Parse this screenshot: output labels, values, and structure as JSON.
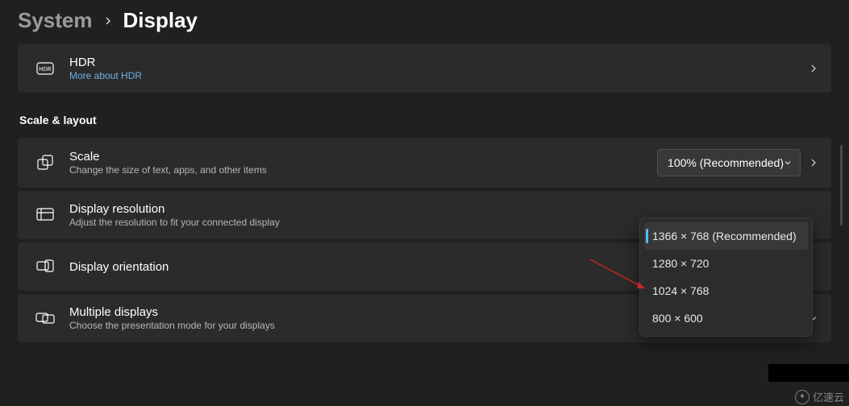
{
  "breadcrumb": {
    "parent": "System",
    "current": "Display"
  },
  "hdr_card": {
    "title": "HDR",
    "link": "More about HDR"
  },
  "section_scale": "Scale & layout",
  "scale_card": {
    "title": "Scale",
    "subtitle": "Change the size of text, apps, and other items",
    "selected": "100% (Recommended)"
  },
  "resolution_card": {
    "title": "Display resolution",
    "subtitle": "Adjust the resolution to fit your connected display",
    "options": [
      "1366 × 768 (Recommended)",
      "1280 × 720",
      "1024 × 768",
      "800 × 600"
    ],
    "selected_index": 0
  },
  "orientation_card": {
    "title": "Display orientation"
  },
  "multiple_card": {
    "title": "Multiple displays",
    "subtitle": "Choose the presentation mode for your displays"
  },
  "watermark": "亿速云"
}
